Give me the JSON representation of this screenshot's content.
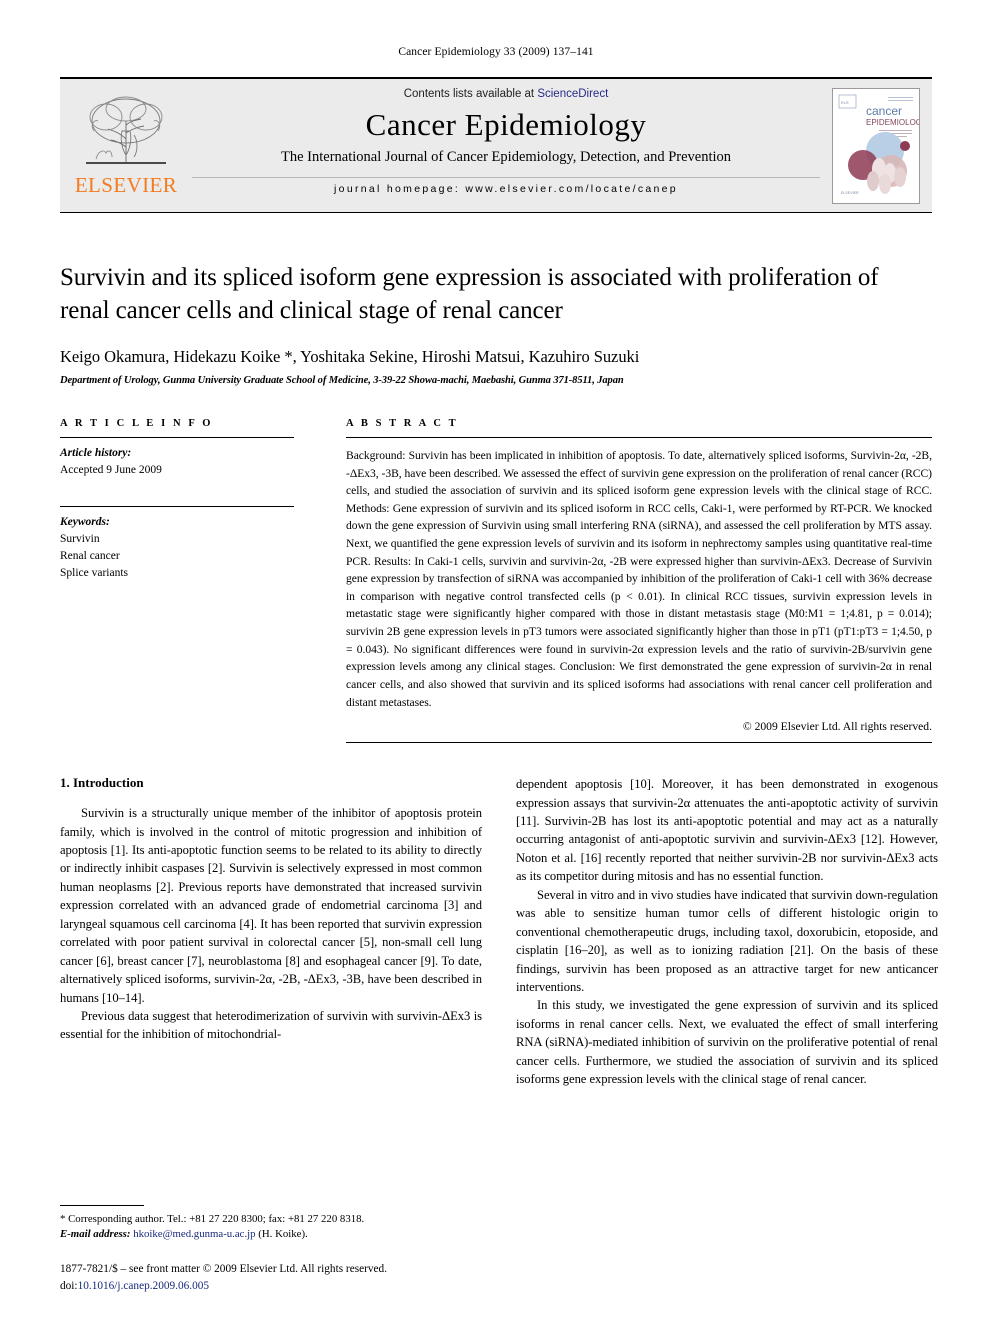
{
  "running_head": "Cancer Epidemiology 33 (2009) 137–141",
  "masthead": {
    "contents_prefix": "Contents lists available at ",
    "sciencedirect": "ScienceDirect",
    "journal_title": "Cancer Epidemiology",
    "journal_subtitle": "The International Journal of Cancer Epidemiology, Detection, and Prevention",
    "homepage": "journal homepage: www.elsevier.com/locate/canep",
    "publisher_logo_text": "ELSEVIER",
    "cover": {
      "title_line1": "cancer",
      "title_line2": "EPIDEMIOLOGY",
      "subtitle": "The International Journal of Cancer Epidemiology, Detection, and Prevention",
      "footer": "ELSEVIER"
    },
    "accent_orange": "#f47b20",
    "link_blue": "#2a2a8c",
    "band_bg": "#ebebeb"
  },
  "article": {
    "title": "Survivin and its spliced isoform gene expression is associated with proliferation of renal cancer cells and clinical stage of renal cancer",
    "authors": "Keigo Okamura, Hidekazu Koike *, Yoshitaka Sekine, Hiroshi Matsui, Kazuhiro Suzuki",
    "affiliation": "Department of Urology, Gunma University Graduate School of Medicine, 3-39-22 Showa-machi, Maebashi, Gunma 371-8511, Japan"
  },
  "article_info": {
    "heading": "A R T I C L E   I N F O",
    "history_label": "Article history:",
    "history_value": "Accepted 9 June 2009",
    "keywords_label": "Keywords:",
    "keywords": [
      "Survivin",
      "Renal cancer",
      "Splice variants"
    ]
  },
  "abstract": {
    "heading": "A B S T R A C T",
    "text": "Background: Survivin has been implicated in inhibition of apoptosis. To date, alternatively spliced isoforms, Survivin-2α, -2B, -ΔEx3, -3B, have been described. We assessed the effect of survivin gene expression on the proliferation of renal cancer (RCC) cells, and studied the association of survivin and its spliced isoform gene expression levels with the clinical stage of RCC. Methods: Gene expression of survivin and its spliced isoform in RCC cells, Caki-1, were performed by RT-PCR. We knocked down the gene expression of Survivin using small interfering RNA (siRNA), and assessed the cell proliferation by MTS assay. Next, we quantified the gene expression levels of survivin and its isoform in nephrectomy samples using quantitative real-time PCR. Results: In Caki-1 cells, survivin and survivin-2α, -2B were expressed higher than survivin-ΔEx3. Decrease of Survivin gene expression by transfection of siRNA was accompanied by inhibition of the proliferation of Caki-1 cell with 36% decrease in comparison with negative control transfected cells (p < 0.01). In clinical RCC tissues, survivin expression levels in metastatic stage were significantly higher compared with those in distant metastasis stage (M0:M1 = 1;4.81, p = 0.014); survivin 2B gene expression levels in pT3 tumors were associated significantly higher than those in pT1 (pT1:pT3 = 1;4.50, p = 0.043). No significant differences were found in survivin-2α expression levels and the ratio of survivin-2B/survivin gene expression levels among any clinical stages. Conclusion: We first demonstrated the gene expression of survivin-2α in renal cancer cells, and also showed that survivin and its spliced isoforms had associations with renal cancer cell proliferation and distant metastases.",
    "copyright": "© 2009 Elsevier Ltd. All rights reserved."
  },
  "body": {
    "section_heading": "1. Introduction",
    "left_paragraphs": [
      "Survivin is a structurally unique member of the inhibitor of apoptosis protein family, which is involved in the control of mitotic progression and inhibition of apoptosis [1]. Its anti-apoptotic function seems to be related to its ability to directly or indirectly inhibit caspases [2]. Survivin is selectively expressed in most common human neoplasms [2]. Previous reports have demonstrated that increased survivin expression correlated with an advanced grade of endometrial carcinoma [3] and laryngeal squamous cell carcinoma [4]. It has been reported that survivin expression correlated with poor patient survival in colorectal cancer [5], non-small cell lung cancer [6], breast cancer [7], neuroblastoma [8] and esophageal cancer [9]. To date, alternatively spliced isoforms, survivin-2α, -2B, -ΔEx3, -3B, have been described in humans [10–14].",
      "Previous data suggest that heterodimerization of survivin with survivin-ΔEx3 is essential for the inhibition of mitochondrial-"
    ],
    "right_paragraphs": [
      "dependent apoptosis [10]. Moreover, it has been demonstrated in exogenous expression assays that survivin-2α attenuates the anti-apoptotic activity of survivin [11]. Survivin-2B has lost its anti-apoptotic potential and may act as a naturally occurring antagonist of anti-apoptotic survivin and survivin-ΔEx3 [12]. However, Noton et al. [16] recently reported that neither survivin-2B nor survivin-ΔEx3 acts as its competitor during mitosis and has no essential function.",
      "Several in vitro and in vivo studies have indicated that survivin down-regulation was able to sensitize human tumor cells of different histologic origin to conventional chemotherapeutic drugs, including taxol, doxorubicin, etoposide, and cisplatin [16–20], as well as to ionizing radiation [21]. On the basis of these findings, survivin has been proposed as an attractive target for new anticancer interventions.",
      "In this study, we investigated the gene expression of survivin and its spliced isoforms in renal cancer cells. Next, we evaluated the effect of small interfering RNA (siRNA)-mediated inhibition of survivin on the proliferative potential of renal cancer cells. Furthermore, we studied the association of survivin and its spliced isoforms gene expression levels with the clinical stage of renal cancer."
    ]
  },
  "footnote": {
    "corresponding": "* Corresponding author. Tel.: +81 27 220 8300; fax: +81 27 220 8318.",
    "email_label": "E-mail address:",
    "email": "hkoike@med.gunma-u.ac.jp",
    "email_owner": "(H. Koike)."
  },
  "imprint": {
    "line1": "1877-7821/$ – see front matter © 2009 Elsevier Ltd. All rights reserved.",
    "doi_label": "doi:",
    "doi_value": "10.1016/j.canep.2009.06.005"
  }
}
